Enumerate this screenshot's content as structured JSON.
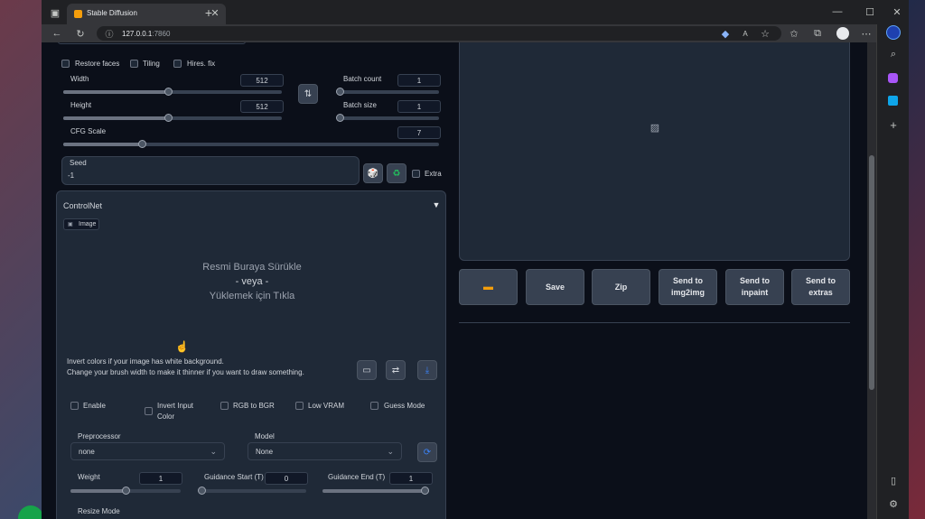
{
  "browser": {
    "tab_title": "Stable Diffusion",
    "url_host": "127.0.0.1",
    "url_port": ":7860"
  },
  "txt2img": {
    "restore_faces": "Restore faces",
    "tiling": "Tiling",
    "hires_fix": "Hires. fix",
    "width_label": "Width",
    "width_value": "512",
    "height_label": "Height",
    "height_value": "512",
    "batch_count_label": "Batch count",
    "batch_count_value": "1",
    "batch_size_label": "Batch size",
    "batch_size_value": "1",
    "cfg_label": "CFG Scale",
    "cfg_value": "7",
    "seed_label": "Seed",
    "seed_value": "-1",
    "extra_label": "Extra"
  },
  "controlnet": {
    "title": "ControlNet",
    "image_tab": "Image",
    "drop_line1": "Resmi Buraya Sürükle",
    "drop_line2": "- veya -",
    "drop_line3": "Yüklemek için Tıkla",
    "hint_line1": "Invert colors if your image has white background.",
    "hint_line2": "Change your brush width to make it thinner if you want to draw something.",
    "enable": "Enable",
    "invert_line1": "Invert Input",
    "invert_line2": "Color",
    "rgb_to_bgr": "RGB to BGR",
    "low_vram": "Low VRAM",
    "guess_mode": "Guess Mode",
    "preprocessor_label": "Preprocessor",
    "preprocessor_value": "none",
    "model_label": "Model",
    "model_value": "None",
    "weight_label": "Weight",
    "weight_value": "1",
    "guidance_start_label": "Guidance Start (T)",
    "guidance_start_value": "0",
    "guidance_end_label": "Guidance End (T)",
    "guidance_end_value": "1",
    "resize_mode_label": "Resize Mode"
  },
  "output": {
    "save": "Save",
    "zip": "Zip",
    "send_img2img_1": "Send to",
    "send_img2img_2": "img2img",
    "send_inpaint_1": "Send to",
    "send_inpaint_2": "inpaint",
    "send_extras_1": "Send to",
    "send_extras_2": "extras"
  },
  "colors": {
    "background": "#0b0f19",
    "panel": "#1f2937",
    "accent_green": "#22c55e",
    "accent_blue": "#3b82f6"
  },
  "slider_levels": {
    "width": 0.48,
    "height": 0.48,
    "cfg": 0.21,
    "batch_count": 0.0,
    "batch_size": 0.0,
    "weight": 0.5,
    "guidance_start": 0.0,
    "guidance_end": 1.0
  }
}
